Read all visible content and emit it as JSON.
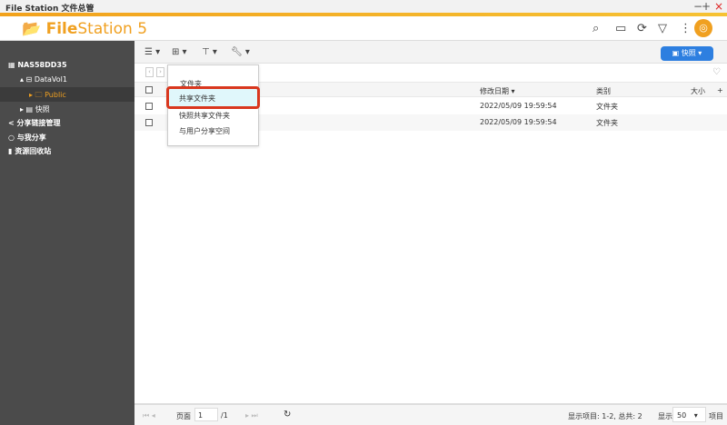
{
  "window": {
    "title": "File Station 文件总管",
    "minimize": "−",
    "maximize": "+",
    "close": "×"
  },
  "header": {
    "logo_bold": "File",
    "logo_rest": "Station 5"
  },
  "sidebar": {
    "nas": "NAS58DD35",
    "volume": "DataVol1",
    "public": "Public",
    "snapshot": "快照",
    "share_links": "分享链接管理",
    "shared_with_me": "与我分享",
    "recycle_bin": "资源回收站"
  },
  "toolbar": {
    "snapshot_button": "快照"
  },
  "menu": {
    "items": [
      "文件夹",
      "共享文件夹",
      "快照共享文件夹",
      "与用户分享空间"
    ]
  },
  "table": {
    "columns": {
      "modified": "修改日期 ▾",
      "type": "类别",
      "size": "大小",
      "add": "+"
    },
    "rows": [
      {
        "modified": "2022/05/09 19:59:54",
        "type": "文件夹"
      },
      {
        "modified": "2022/05/09 19:59:54",
        "type": "文件夹"
      }
    ]
  },
  "footer": {
    "page_label": "页面",
    "page_value": "1",
    "page_total": "/1",
    "items_info": "显示项目: 1-2, 总共: 2",
    "show_label": "显示",
    "per_page": "50",
    "items_label": "项目"
  },
  "colors": {
    "accent": "#f0a020",
    "highlight": "#d9371e",
    "button": "#2d7fe0"
  }
}
